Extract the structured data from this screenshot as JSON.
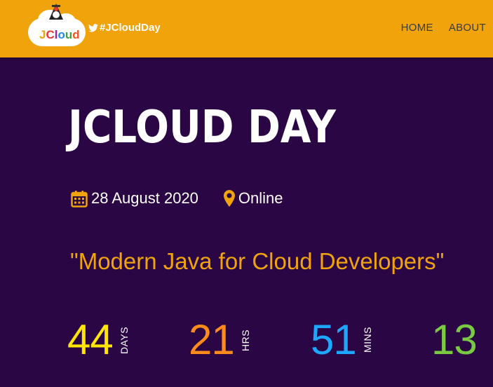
{
  "navbar": {
    "logo_text": {
      "j": "J",
      "c1": "C",
      "c2": "l",
      "c3": "o",
      "c4": "u",
      "c5": "d"
    },
    "hashtag": "#JCloudDay",
    "links": [
      "HOME",
      "ABOUT"
    ]
  },
  "hero": {
    "title": "JCLOUD DAY",
    "date": "28 August 2020",
    "location": "Online",
    "tagline": "\"Modern Java for Cloud Developers\""
  },
  "countdown": [
    {
      "value": "44",
      "unit": "DAYS",
      "color": "#ffe600"
    },
    {
      "value": "21",
      "unit": "HRS",
      "color": "#ff8c1a"
    },
    {
      "value": "51",
      "unit": "MINS",
      "color": "#1ea7ff"
    },
    {
      "value": "13",
      "unit": "",
      "color": "#7ac943"
    }
  ],
  "colors": {
    "navbar_bg": "#f0a30a",
    "page_bg": "#2b0644",
    "accent": "#f0a30a"
  },
  "icons": {
    "twitter": "twitter-icon",
    "calendar": "calendar-icon",
    "location": "map-marker-icon",
    "mascot": "duke-mascot-icon"
  }
}
